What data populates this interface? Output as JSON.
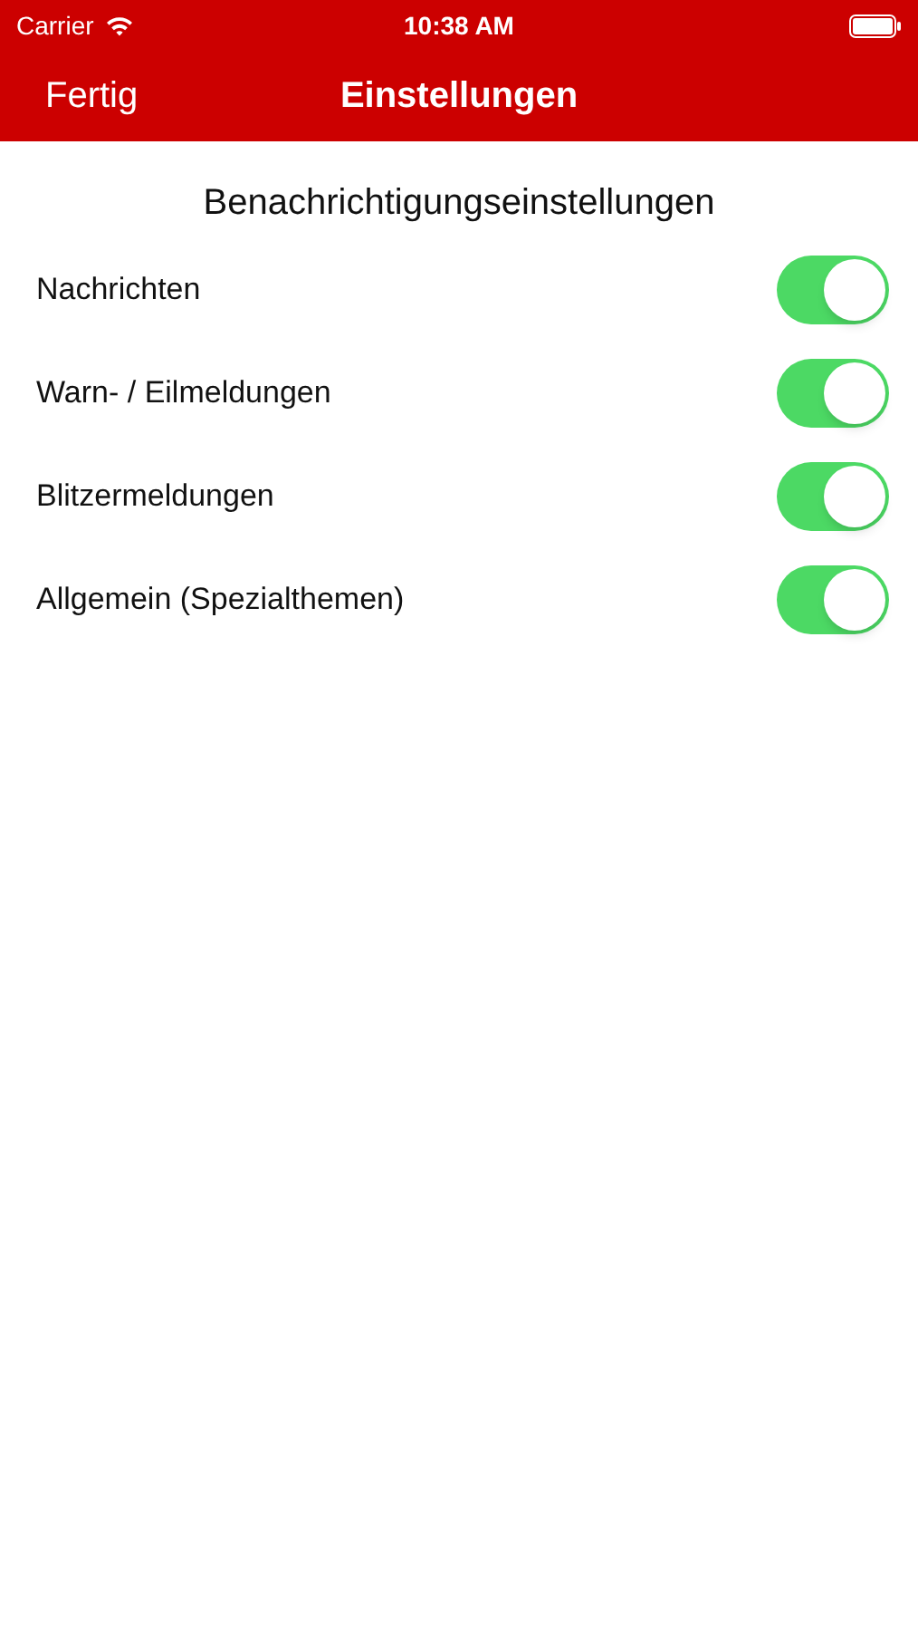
{
  "status_bar": {
    "carrier": "Carrier",
    "time": "10:38 AM"
  },
  "nav_bar": {
    "back_button": "Fertig",
    "title": "Einstellungen"
  },
  "section": {
    "title": "Benachrichtigungseinstellungen"
  },
  "settings": [
    {
      "label": "Nachrichten",
      "on": true
    },
    {
      "label": "Warn- / Eilmeldungen",
      "on": true
    },
    {
      "label": "Blitzermeldungen",
      "on": true
    },
    {
      "label": "Allgemein (Spezialthemen)",
      "on": true
    }
  ]
}
